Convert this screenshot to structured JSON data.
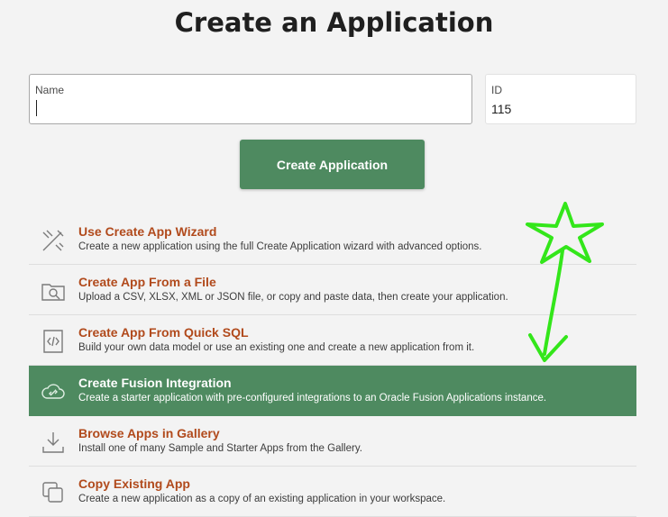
{
  "page": {
    "title": "Create an Application"
  },
  "form": {
    "name": {
      "label": "Name",
      "value": ""
    },
    "id": {
      "label": "ID",
      "value": "115"
    },
    "create_button_label": "Create Application"
  },
  "options": [
    {
      "title": "Use Create App Wizard",
      "description": "Create a new application using the full Create Application wizard with advanced options.",
      "icon": "wizard-icon"
    },
    {
      "title": "Create App From a File",
      "description": "Upload a CSV, XLSX, XML or JSON file, or copy and paste data, then create your application.",
      "icon": "folder-search-icon"
    },
    {
      "title": "Create App From Quick SQL",
      "description": "Build your own data model or use an existing one and create a new application from it.",
      "icon": "code-icon"
    },
    {
      "title": "Create Fusion Integration",
      "description": "Create a starter application with pre-configured integrations to an Oracle Fusion Applications instance.",
      "icon": "cloud-link-icon",
      "selected": true
    },
    {
      "title": "Browse Apps in Gallery",
      "description": "Install one of many Sample and Starter Apps from the Gallery.",
      "icon": "download-icon"
    },
    {
      "title": "Copy Existing App",
      "description": "Create a new application as a copy of an existing application in your workspace.",
      "icon": "copy-icon"
    }
  ],
  "colors": {
    "accent": "#4e8a60",
    "option_title": "#b14a1c",
    "annotation": "#33e61a"
  }
}
